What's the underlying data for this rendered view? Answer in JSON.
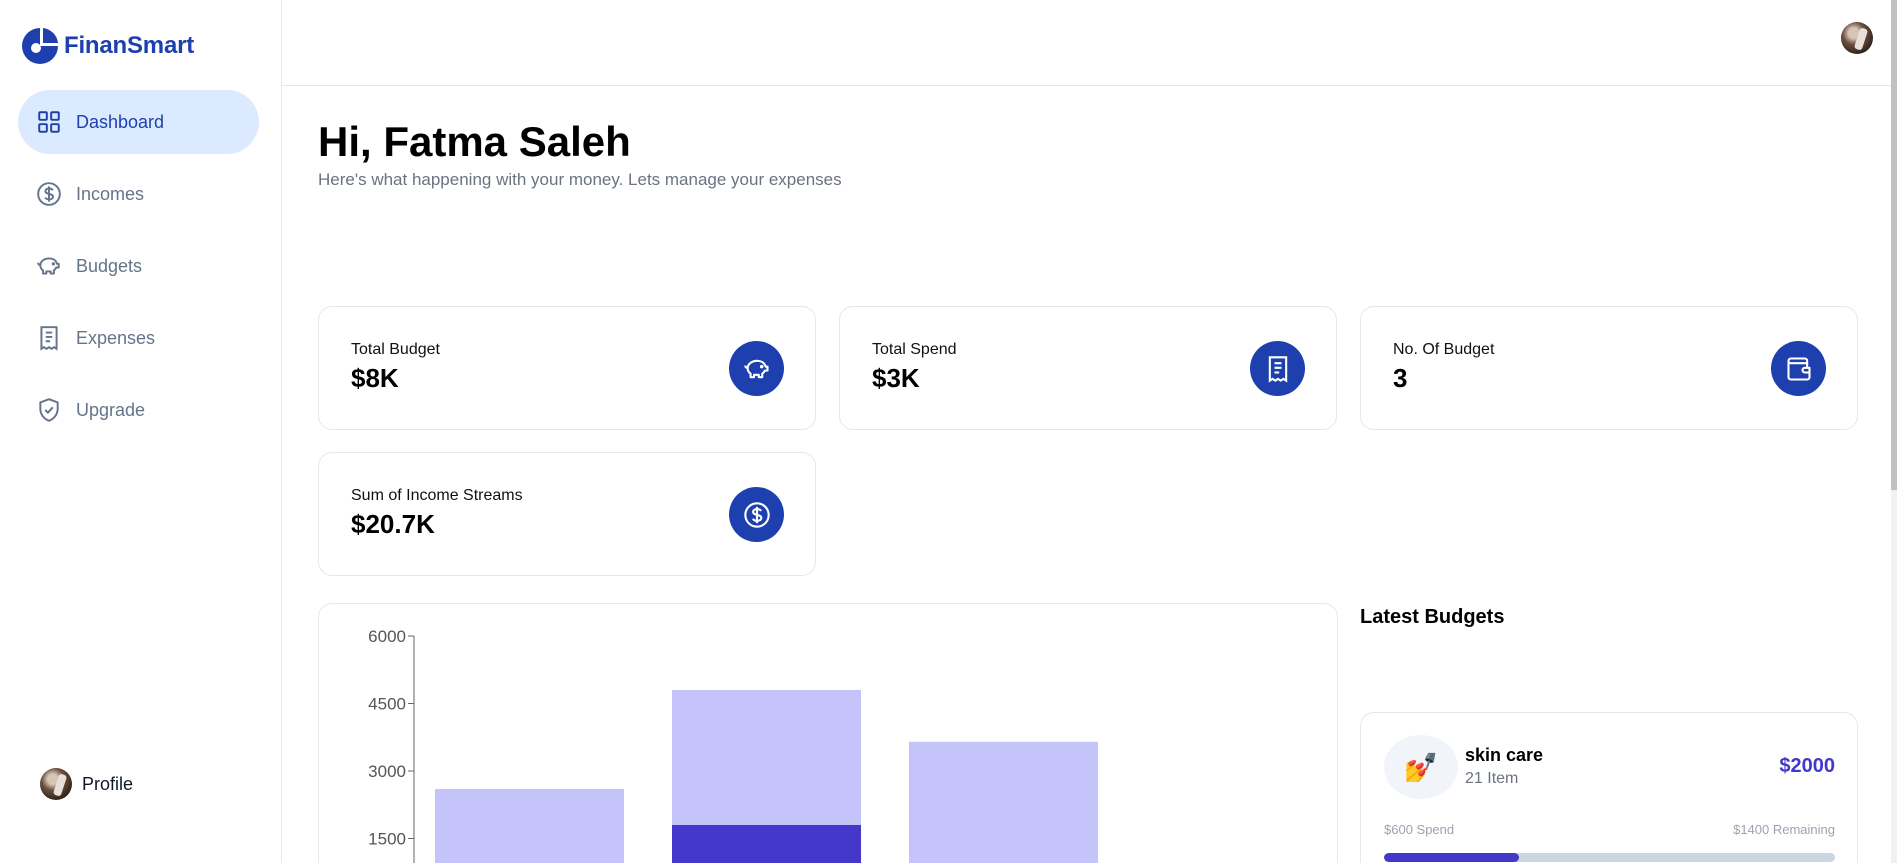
{
  "app": {
    "name": "FinanSmart",
    "brand_color": "#1e40af"
  },
  "sidebar": {
    "items": [
      {
        "label": "Dashboard",
        "icon": "grid-icon",
        "active": true
      },
      {
        "label": "Incomes",
        "icon": "dollar-circle-icon",
        "active": false
      },
      {
        "label": "Budgets",
        "icon": "piggy-bank-icon",
        "active": false
      },
      {
        "label": "Expenses",
        "icon": "receipt-icon",
        "active": false
      },
      {
        "label": "Upgrade",
        "icon": "shield-check-icon",
        "active": false
      }
    ],
    "profile_label": "Profile"
  },
  "main": {
    "greeting": "Hi, Fatma Saleh",
    "subtitle": "Here's what happening with your money. Lets manage your expenses",
    "cards": [
      {
        "label": "Total Budget",
        "value": "$8K",
        "icon": "piggy-bank-icon"
      },
      {
        "label": "Total Spend",
        "value": "$3K",
        "icon": "receipt-icon"
      },
      {
        "label": "No. Of Budget",
        "value": "3",
        "icon": "wallet-icon"
      },
      {
        "label": "Sum of Income Streams",
        "value": "$20.7K",
        "icon": "dollar-circle-icon"
      }
    ]
  },
  "chart_data": {
    "type": "bar",
    "stacked": true,
    "categories": [
      "",
      "",
      ""
    ],
    "series": [
      {
        "values": [
          0,
          1800,
          0
        ],
        "color": "#4338ca"
      },
      {
        "values": [
          2600,
          3000,
          3650
        ],
        "color": "#c4c4fb"
      }
    ],
    "yticks": [
      1500,
      3000,
      4500,
      6000
    ],
    "ylim": [
      0,
      6000
    ],
    "grid": false
  },
  "latest_budgets": {
    "title": "Latest Budgets",
    "items": [
      {
        "emoji": "💅",
        "name": "skin care",
        "items_text": "21 Item",
        "amount": "$2000",
        "spend_text": "$600 Spend",
        "remaining_text": "$1400 Remaining",
        "progress": 0.3
      }
    ]
  }
}
